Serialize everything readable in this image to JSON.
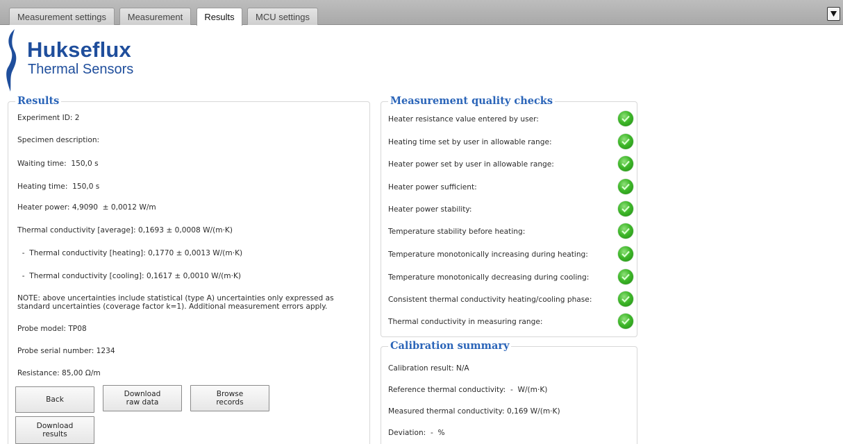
{
  "tabs": [
    {
      "label": "Measurement settings"
    },
    {
      "label": "Measurement"
    },
    {
      "label": "Results"
    },
    {
      "label": "MCU settings"
    }
  ],
  "active_tab": "Results",
  "menu_icon": "dropdown-arrow-icon",
  "logo": {
    "title": "Hukseflux",
    "subtitle": "Thermal Sensors",
    "brand_color": "#1f4e9c"
  },
  "results": {
    "title": "Results",
    "experiment_id": "Experiment ID: 2",
    "specimen_description": "Specimen description:",
    "waiting_time": "Waiting time:  150,0 s",
    "heating_time": "Heating time:  150,0 s",
    "heater_power": "Heater power: 4,9090  ± 0,0012 W/m",
    "tc_average": "Thermal conductivity [average]: 0,1693 ± 0,0008 W/(m·K)",
    "tc_heating": "  -  Thermal conductivity [heating]: 0,1770 ± 0,0013 W/(m·K)",
    "tc_cooling": "  -  Thermal conductivity [cooling]: 0,1617 ± 0,0010 W/(m·K)",
    "note_line1": "NOTE: above uncertainties include statistical (type A) uncertainties only expressed as",
    "note_line2": "standard uncertainties (coverage factor k=1). Additional measurement errors apply.",
    "probe_model": "Probe model: TP08",
    "probe_serial": "Probe serial number: 1234",
    "resistance": "Resistance: 85,00 Ω/m"
  },
  "buttons": {
    "back": "Back",
    "download_raw": "Download\nraw data",
    "browse_records": "Browse\nrecords",
    "download_results": "Download\nresults"
  },
  "quality_checks": {
    "title": "Measurement quality checks",
    "status_color": "#3fb82a",
    "items": [
      {
        "label": "Heater resistance value entered by user:",
        "status": "ok"
      },
      {
        "label": "Heating time set by user in allowable range:",
        "status": "ok"
      },
      {
        "label": "Heater power set by user in allowable range:",
        "status": "ok"
      },
      {
        "label": "Heater power sufficient:",
        "status": "ok"
      },
      {
        "label": "Heater power stability:",
        "status": "ok"
      },
      {
        "label": "Temperature stability before heating:",
        "status": "ok"
      },
      {
        "label": "Temperature monotonically increasing during heating:",
        "status": "ok"
      },
      {
        "label": "Temperature monotonically decreasing during cooling:",
        "status": "ok"
      },
      {
        "label": "Consistent thermal conductivity heating/cooling phase:",
        "status": "ok"
      },
      {
        "label": "Thermal conductivity in measuring range:",
        "status": "ok"
      }
    ]
  },
  "calibration": {
    "title": "Calibration summary",
    "result": "Calibration result: N/A",
    "reference": "Reference thermal conductivity:  -  W/(m·K)",
    "measured": "Measured thermal conductivity: 0,169 W/(m·K)",
    "deviation": "Deviation:  -  %"
  }
}
